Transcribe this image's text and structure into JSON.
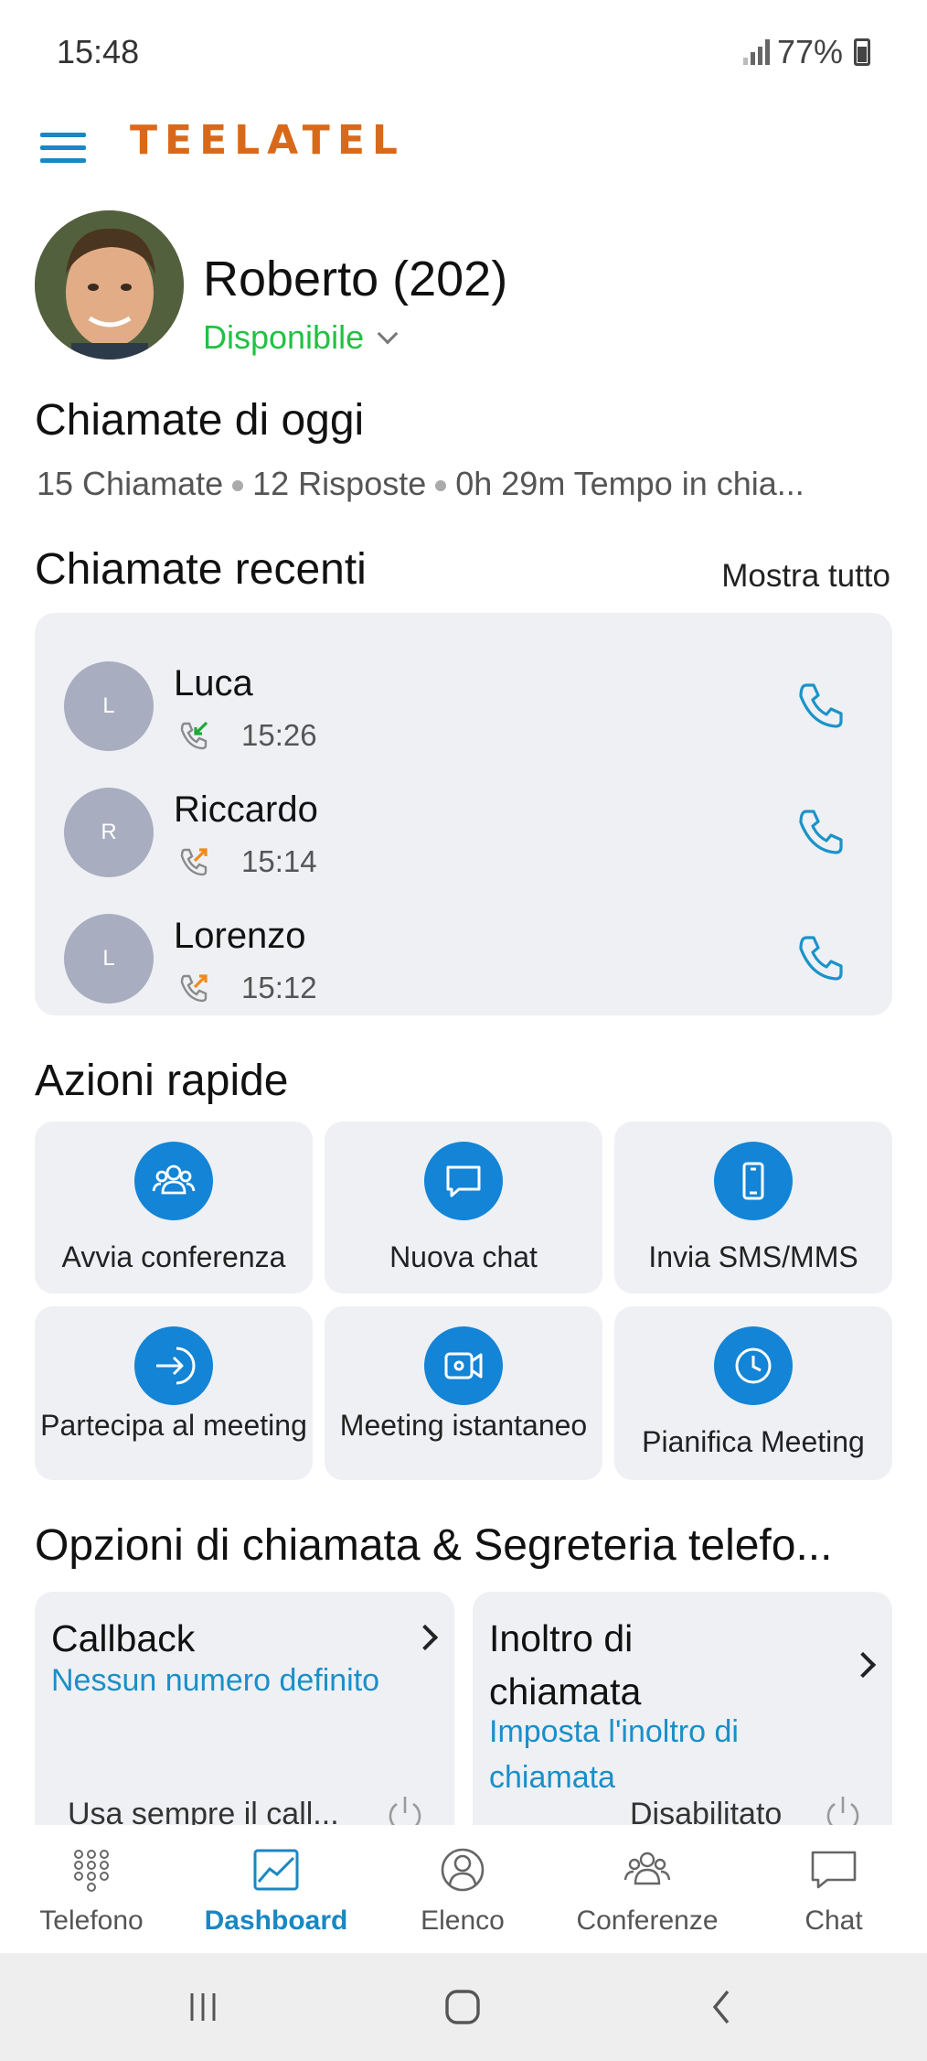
{
  "status_bar": {
    "time": "15:48",
    "battery": "77%"
  },
  "header": {
    "logo": "TEELATEL"
  },
  "profile": {
    "name": "Roberto (202)",
    "status": "Disponibile"
  },
  "today": {
    "title": "Chiamate di oggi",
    "calls": "15 Chiamate",
    "answered": "12 Risposte",
    "duration": "0h 29m Tempo in chia..."
  },
  "recent": {
    "title": "Chiamate recenti",
    "show_all": "Mostra tutto",
    "items": [
      {
        "initial": "L",
        "name": "Luca",
        "time": "15:26",
        "direction": "incoming",
        "arrow_color": "#1fa83a"
      },
      {
        "initial": "R",
        "name": "Riccardo",
        "time": "15:14",
        "direction": "outgoing",
        "arrow_color": "#f08a1c"
      },
      {
        "initial": "L",
        "name": "Lorenzo",
        "time": "15:12",
        "direction": "outgoing",
        "arrow_color": "#f08a1c"
      }
    ]
  },
  "quick_actions": {
    "title": "Azioni rapide",
    "items": [
      {
        "label": "Avvia conferenza",
        "icon": "conference-icon"
      },
      {
        "label": "Nuova chat",
        "icon": "chat-bubble-icon"
      },
      {
        "label": "Invia SMS/MMS",
        "icon": "mobile-phone-icon"
      },
      {
        "label": "Partecipa al meeting",
        "icon": "join-arrow-icon"
      },
      {
        "label": "Meeting istantaneo",
        "icon": "video-camera-icon"
      },
      {
        "label": "Pianifica Meeting",
        "icon": "clock-icon"
      }
    ]
  },
  "call_options": {
    "title": "Opzioni di chiamata & Segreteria telefo...",
    "callback": {
      "title": "Callback",
      "subtitle": "Nessun numero definito",
      "footer": "Usa sempre il call..."
    },
    "forwarding": {
      "title_line1": "Inoltro di",
      "title_line2": "chiamata",
      "subtitle_line1": "Imposta l'inoltro di",
      "subtitle_line2": "chiamata",
      "footer": "Disabilitato"
    }
  },
  "bottom_nav": {
    "items": [
      {
        "label": "Telefono",
        "icon": "dialpad-icon"
      },
      {
        "label": "Dashboard",
        "icon": "dashboard-chart-icon",
        "active": true
      },
      {
        "label": "Elenco",
        "icon": "contacts-icon"
      },
      {
        "label": "Conferenze",
        "icon": "conference-icon"
      },
      {
        "label": "Chat",
        "icon": "chat-bubble-icon"
      }
    ]
  },
  "colors": {
    "accent": "#1a87c3",
    "action_blue": "#1384d6",
    "available": "#21c143",
    "brand": "#d9691a"
  }
}
